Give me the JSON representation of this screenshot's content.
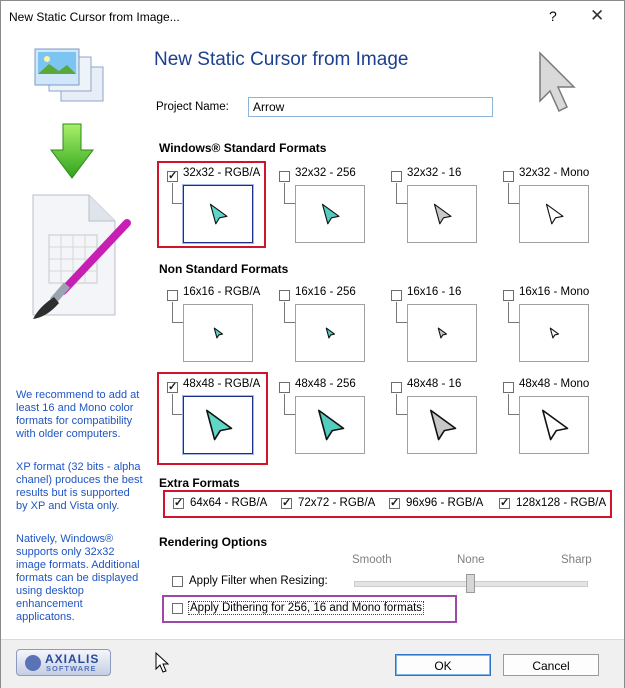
{
  "window": {
    "title": "New Static Cursor from Image...",
    "help_glyph": "?",
    "close_glyph": "✕"
  },
  "heading": "New Static Cursor from Image",
  "project": {
    "label": "Project Name:",
    "value": "Arrow"
  },
  "sections": {
    "standard": "Windows® Standard Formats",
    "nonstandard": "Non Standard Formats",
    "extra": "Extra Formats",
    "rendering": "Rendering Options"
  },
  "standard_formats": [
    {
      "label": "32x32 - RGB/A",
      "checked": true
    },
    {
      "label": "32x32 - 256",
      "checked": false
    },
    {
      "label": "32x32 - 16",
      "checked": false
    },
    {
      "label": "32x32 - Mono",
      "checked": false
    }
  ],
  "nonstandard_small": [
    {
      "label": "16x16 - RGB/A",
      "checked": false
    },
    {
      "label": "16x16 - 256",
      "checked": false
    },
    {
      "label": "16x16 - 16",
      "checked": false
    },
    {
      "label": "16x16 - Mono",
      "checked": false
    }
  ],
  "nonstandard_large": [
    {
      "label": "48x48 - RGB/A",
      "checked": true
    },
    {
      "label": "48x48 - 256",
      "checked": false
    },
    {
      "label": "48x48 - 16",
      "checked": false
    },
    {
      "label": "48x48 - Mono",
      "checked": false
    }
  ],
  "extra_formats": [
    {
      "label": "64x64 - RGB/A",
      "checked": true
    },
    {
      "label": "72x72 - RGB/A",
      "checked": true
    },
    {
      "label": "96x96 - RGB/A",
      "checked": true
    },
    {
      "label": "128x128 - RGB/A",
      "checked": true
    }
  ],
  "rendering": {
    "filter_label": "Apply Filter when Resizing:",
    "filter_checked": false,
    "dither_label": "Apply Dithering for 256, 16 and Mono formats",
    "dither_checked": false,
    "slider_labels": [
      "Smooth",
      "None",
      "Sharp"
    ],
    "slider_level": 0.5
  },
  "left_text": [
    "We recommend to add at least 16 and Mono color formats for compatibility with older computers.",
    "XP format (32 bits - alpha chanel) produces the best results but is supported by XP and Vista only.",
    "Natively, Windows® supports only 32x32 image formats. Additional formats can be displayed using desktop enhancement applicatons."
  ],
  "logo": {
    "line1": "AXIALIS",
    "line2": "SOFTWARE"
  },
  "buttons": {
    "ok": "OK",
    "cancel": "Cancel"
  },
  "colors": {
    "accent": "#1d3f8f",
    "highlight_red": "#d0142a",
    "highlight_purple": "#9c4aa6",
    "cursor_fill": "#5fd6c8"
  }
}
